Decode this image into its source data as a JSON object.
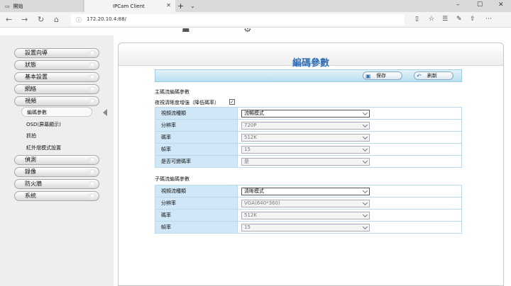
{
  "browser": {
    "tabs": [
      {
        "label": "開始",
        "active": false
      },
      {
        "label": "IPCam Client",
        "active": true
      }
    ],
    "new_tab_symbol": "+",
    "tab_menu_symbol": "⌄",
    "window_controls": [
      "–",
      "☐",
      "✕"
    ],
    "url": "172.20.10.4:88/",
    "nav": {
      "back": "←",
      "forward": "→",
      "refresh": "↻",
      "home": "⌂"
    },
    "toolbar_icons": [
      "reading-view-icon",
      "favorites-star-icon",
      "favorites-hub-icon",
      "notes-pen-icon",
      "share-icon",
      "more-icon"
    ]
  },
  "sidebar": {
    "menu": [
      {
        "label": "設置向導"
      },
      {
        "label": "狀態"
      },
      {
        "label": "基本設置"
      },
      {
        "label": "網絡"
      },
      {
        "label": "視頻"
      }
    ],
    "video_submenu": [
      {
        "label": "編碼參數",
        "selected": true
      },
      {
        "label": "OSD(屏幕顯示)"
      },
      {
        "label": "抓拍"
      },
      {
        "label": "紅外燈模式設置"
      }
    ],
    "menu_after": [
      {
        "label": "偵測"
      },
      {
        "label": "錄像"
      },
      {
        "label": "防火牆"
      },
      {
        "label": "系統"
      }
    ]
  },
  "page": {
    "title": "編碼參數",
    "buttons": {
      "save": "保存",
      "refresh": "刷新"
    },
    "main_stream": {
      "section_label": "主碼流編碼參數",
      "enhance_label": "夜視清晰度增強（降低碼率）",
      "enhance_checked": true,
      "rows": [
        {
          "label": "視頻流種類",
          "value": "流暢模式",
          "enabled": true
        },
        {
          "label": "分辨率",
          "value": "720P",
          "enabled": false
        },
        {
          "label": "碼率",
          "value": "512K",
          "enabled": false
        },
        {
          "label": "幀率",
          "value": "15",
          "enabled": false
        },
        {
          "label": "是否可變碼率",
          "value": "是",
          "enabled": false
        }
      ]
    },
    "sub_stream": {
      "section_label": "子碼流編碼參數",
      "rows": [
        {
          "label": "視頻流種類",
          "value": "清晰模式",
          "enabled": true
        },
        {
          "label": "分辨率",
          "value": "VGA(640*360)",
          "enabled": false
        },
        {
          "label": "碼率",
          "value": "512K",
          "enabled": false
        },
        {
          "label": "幀率",
          "value": "15",
          "enabled": false
        }
      ]
    }
  },
  "colors": {
    "title_blue": "#2f6fb5",
    "label_cell": "#cfe7f6",
    "toolbar_blue": "#b8dff0"
  }
}
